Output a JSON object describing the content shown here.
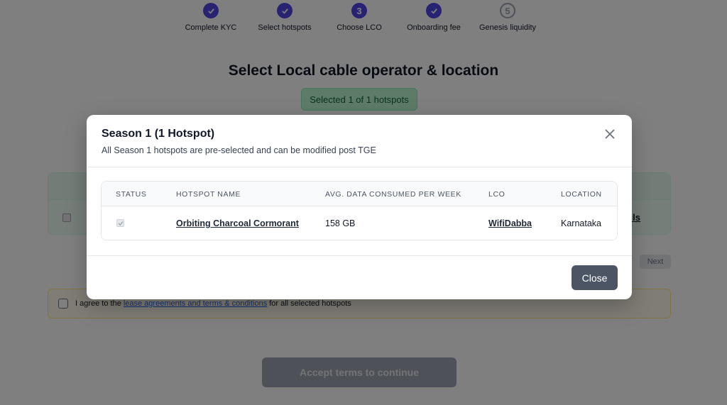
{
  "stepper": {
    "steps": [
      {
        "label": "Complete KYC",
        "state": "done",
        "icon": "check-icon"
      },
      {
        "label": "Select hotspots",
        "state": "done",
        "icon": "check-icon"
      },
      {
        "label": "Choose LCO",
        "state": "current",
        "number": "3"
      },
      {
        "label": "Onboarding fee",
        "state": "done",
        "icon": "check-icon"
      },
      {
        "label": "Genesis liquidity",
        "state": "pending",
        "number": "5"
      }
    ]
  },
  "page": {
    "title": "Select Local cable operator & location",
    "selected_pill": "Selected 1 of 1 hotspots",
    "details_link_fragment": "ils",
    "next_label": "Next",
    "agree": {
      "prefix": "I agree to the",
      "link": "lease agreements and terms & conditions",
      "suffix": "for all selected hotspots"
    },
    "accept_button": "Accept terms to continue"
  },
  "modal": {
    "title": "Season 1 (1 Hotspot)",
    "subtitle": "All Season 1 hotspots are pre-selected and can be modified post TGE",
    "close_label": "Close",
    "table": {
      "headers": [
        "STATUS",
        "HOTSPOT NAME",
        "AVG. DATA CONSUMED PER WEEK",
        "LCO",
        "LOCATION"
      ],
      "rows": [
        {
          "status_checked": true,
          "name": "Orbiting Charcoal Cormorant",
          "avg_data": "158 GB",
          "lco": "WifiDabba",
          "location": "Karnataka"
        }
      ]
    }
  },
  "colors": {
    "accent": "#4f46e5",
    "success_bg": "#bbf7d0",
    "close_button": "#4b5563"
  }
}
